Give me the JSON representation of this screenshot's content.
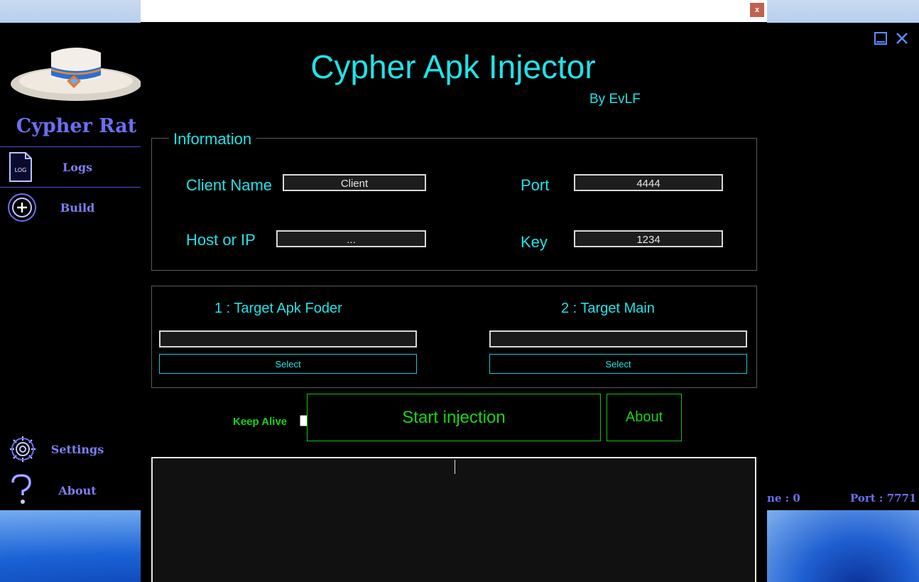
{
  "rat_app": {
    "title": "Cypher Rat",
    "nav": {
      "logs": "Logs",
      "build": "Build",
      "settings": "Settings",
      "about": "About"
    },
    "log_icon_text": "LOG",
    "status_name_partial": "ne : 0",
    "status_port": "Port : 7771"
  },
  "injector": {
    "close_label": "x",
    "title": "Cypher Apk Injector",
    "byline": "By EvLF",
    "information": {
      "legend": "Information",
      "client_name_label": "Client Name",
      "client_name_value": "Client",
      "port_label": "Port",
      "port_value": "4444",
      "host_label": "Host or IP",
      "host_value": "...",
      "key_label": "Key",
      "key_value": "1234"
    },
    "targets": {
      "apk_folder_label": "1 : Target Apk Foder",
      "main_label": "2 : Target Main",
      "select_label": "Select"
    },
    "keep_alive_label": "Keep Alive",
    "start_label": "Start injection",
    "about_label": "About"
  },
  "colors": {
    "cyan": "#1fe3e8",
    "green": "#19d219",
    "purple": "#6b6ff0"
  }
}
